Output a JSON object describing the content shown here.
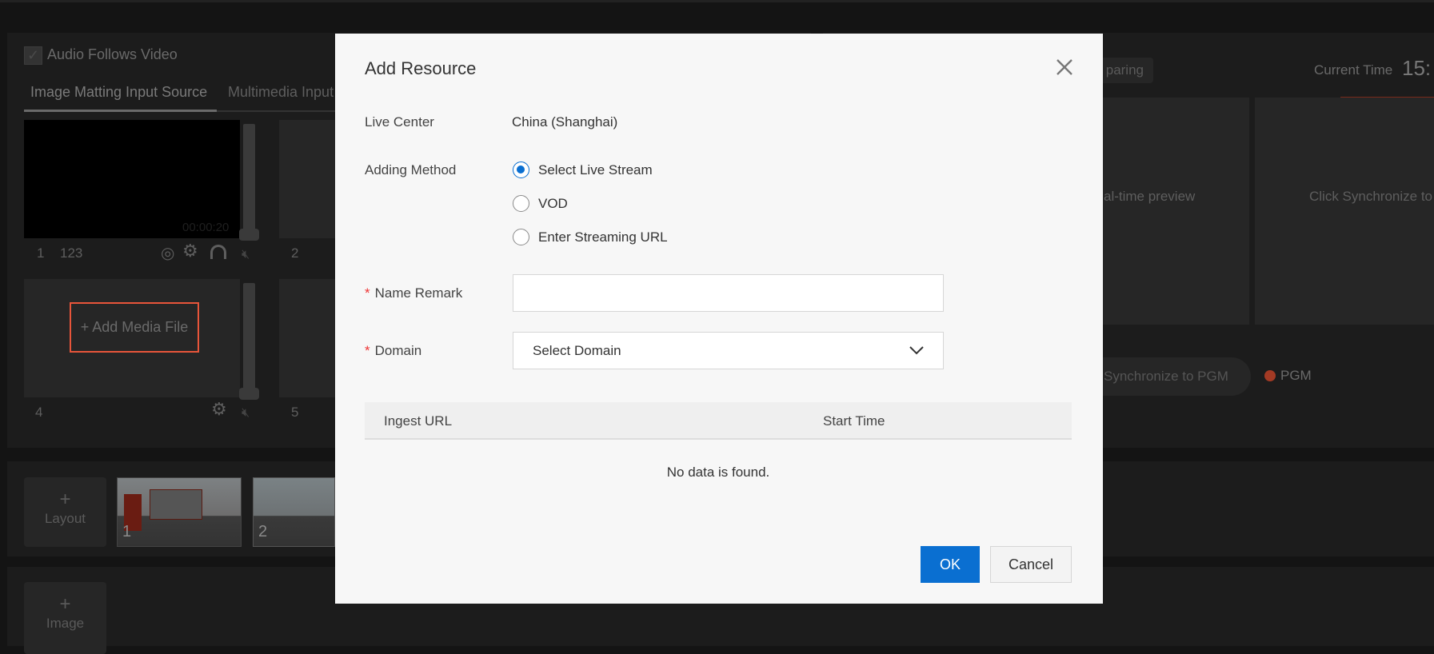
{
  "background": {
    "audio_follows_video": {
      "label": "Audio Follows Video",
      "checked": true
    },
    "tabs": [
      {
        "label": "Image Matting Input Source",
        "active": true
      },
      {
        "label": "Multimedia Input",
        "active": false
      }
    ],
    "tiles": [
      {
        "index": "1",
        "name": "123",
        "timecode": "00:00:20"
      },
      {
        "index": "2"
      },
      {
        "index": "4",
        "add_label": "+ Add Media File"
      },
      {
        "index": "5"
      }
    ],
    "layout_button": {
      "plus": "+",
      "label": "Layout"
    },
    "layout_thumbs": [
      "1",
      "2"
    ],
    "image_button": {
      "plus": "+",
      "label": "Image"
    },
    "preparing_button": "paring",
    "current_time_label": "Current Time",
    "current_time_value": "15:",
    "preview_text": "al-time preview",
    "pgm_hint": "Click Synchronize to",
    "sync_button": "Synchronize to PGM",
    "pgm_label": "PGM",
    "colors": {
      "accent": "#e8553a",
      "pgm_dot": "#a33a24",
      "primary": "#0a6fd1"
    }
  },
  "dialog": {
    "title": "Add Resource",
    "close_icon": "close-icon",
    "live_center": {
      "label": "Live Center",
      "value": "China (Shanghai)"
    },
    "adding_method": {
      "label": "Adding Method",
      "options": [
        {
          "label": "Select Live Stream",
          "selected": true
        },
        {
          "label": "VOD",
          "selected": false
        },
        {
          "label": "Enter Streaming URL",
          "selected": false
        }
      ]
    },
    "name_remark": {
      "label": "Name Remark",
      "required_mark": "*",
      "value": ""
    },
    "domain": {
      "label": "Domain",
      "required_mark": "*",
      "placeholder": "Select Domain"
    },
    "table": {
      "columns": [
        "Ingest URL",
        "Start Time"
      ],
      "empty_text": "No data is found."
    },
    "ok_label": "OK",
    "cancel_label": "Cancel"
  }
}
